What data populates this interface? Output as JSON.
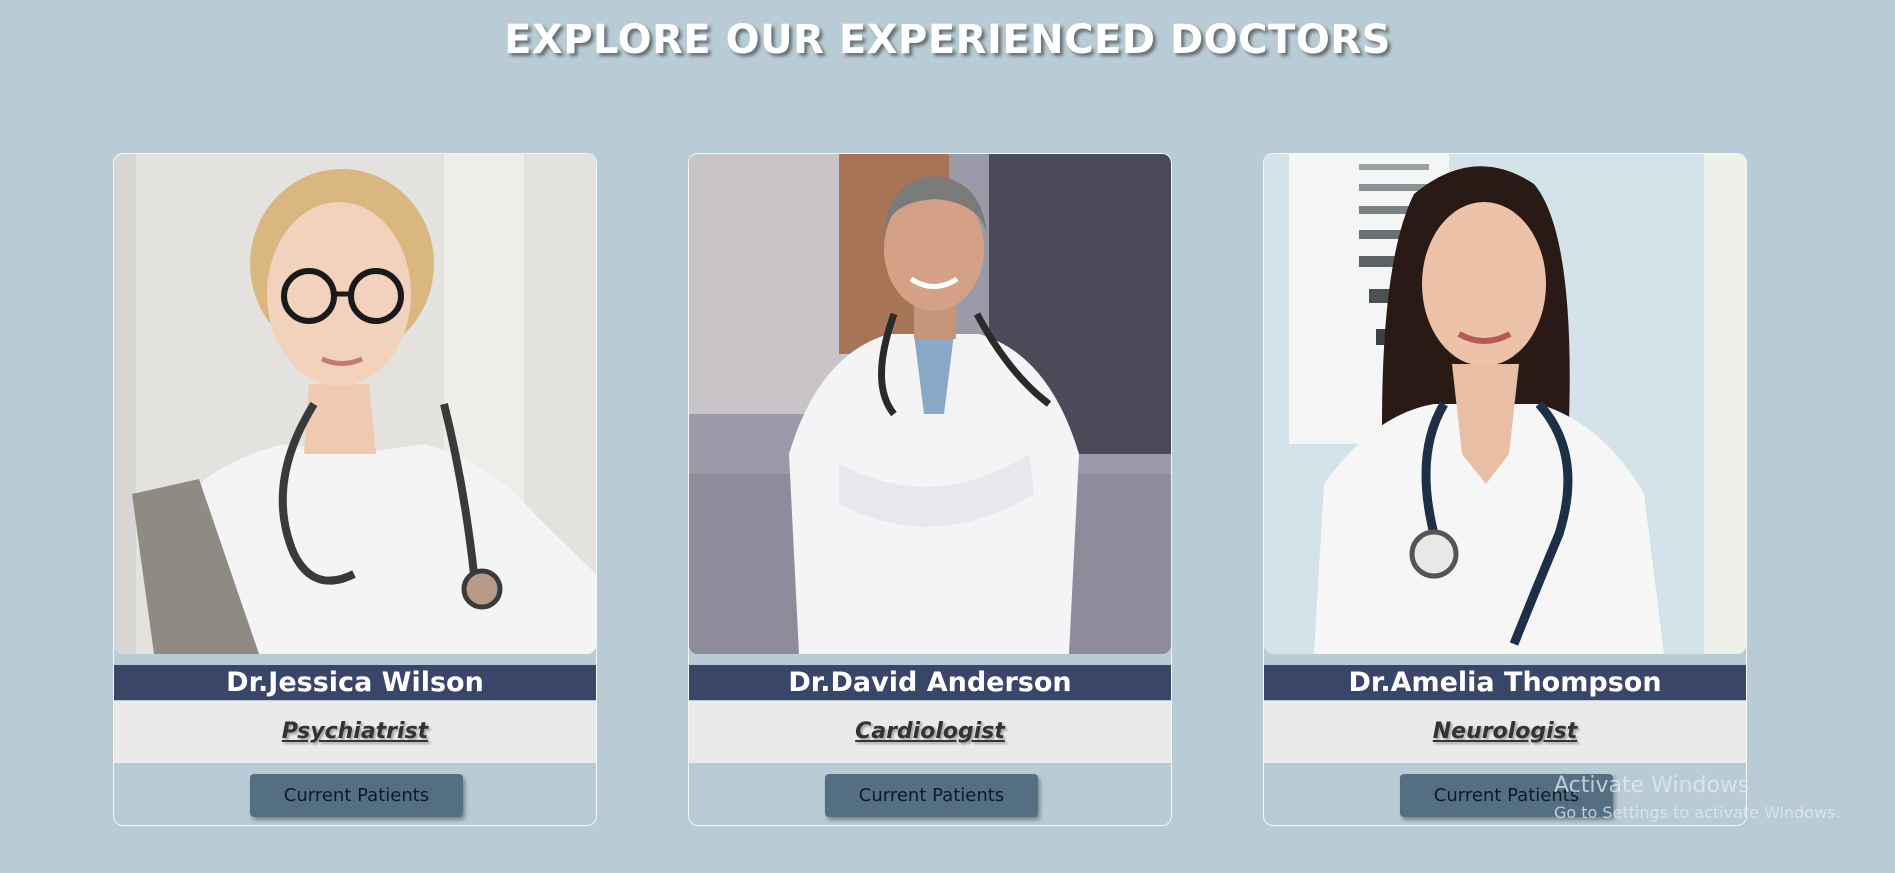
{
  "page": {
    "title": "EXPLORE OUR EXPERIENCED DOCTORS"
  },
  "doctors": [
    {
      "name": "Dr.Jessica Wilson",
      "specialty": "Psychiatrist",
      "button_label": "Current Patients"
    },
    {
      "name": "Dr.David Anderson",
      "specialty": "Cardiologist",
      "button_label": "Current Patients"
    },
    {
      "name": "Dr.Amelia Thompson",
      "specialty": "Neurologist",
      "button_label": "Current Patients"
    }
  ],
  "watermark": {
    "title": "Activate Windows",
    "subtitle": "Go to Settings to activate Windows."
  },
  "colors": {
    "page_background": "#b9cbd4",
    "name_bar": "#3a4668",
    "specialty_bar": "#eaeaea",
    "button": "#546f82"
  }
}
